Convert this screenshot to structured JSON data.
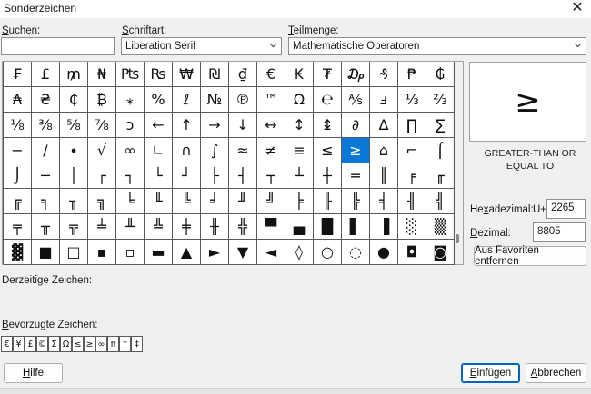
{
  "window": {
    "title": "Sonderzeichen",
    "close_glyph": "✕"
  },
  "search": {
    "label_mnemonic": "S",
    "label_rest": "uchen:",
    "value": "",
    "placeholder": ""
  },
  "font": {
    "label_mnemonic": "S",
    "label_rest": "chriftart:",
    "value": "Liberation Serif"
  },
  "subset": {
    "label_mnemonic": "T",
    "label_rest": "eilmenge:",
    "value": "Mathematische Operatoren"
  },
  "grid": {
    "rows": [
      [
        "₣",
        "£",
        "₥",
        "₦",
        "₧",
        "₨",
        "₩",
        "₪",
        "₫",
        "€",
        "₭",
        "₮",
        "₯",
        "₰",
        "₱",
        "₲"
      ],
      [
        "₳",
        "₴",
        "₵",
        "₿",
        "⁎",
        "%",
        "ℓ",
        "№",
        "℗",
        "™",
        "Ω",
        "℮",
        "⅍",
        "ⅎ",
        "⅓",
        "⅔"
      ],
      [
        "⅛",
        "⅜",
        "⅝",
        "⅞",
        "ↄ",
        "←",
        "↑",
        "→",
        "↓",
        "↔",
        "↕",
        "↨",
        "∂",
        "∆",
        "∏",
        "∑"
      ],
      [
        "−",
        "∕",
        "∙",
        "√",
        "∞",
        "∟",
        "∩",
        "∫",
        "≈",
        "≠",
        "≡",
        "≤",
        "≥",
        "⌂",
        "⌐",
        "⌠"
      ],
      [
        "⌡",
        "─",
        "│",
        "┌",
        "┐",
        "└",
        "┘",
        "├",
        "┤",
        "┬",
        "┴",
        "┼",
        "═",
        "║",
        "╒",
        "╓"
      ],
      [
        "╔",
        "╕",
        "╖",
        "╗",
        "╘",
        "╙",
        "╚",
        "╛",
        "╜",
        "╝",
        "╞",
        "╟",
        "╠",
        "╡",
        "╢",
        "╣"
      ],
      [
        "╤",
        "╥",
        "╦",
        "╧",
        "╨",
        "╩",
        "╪",
        "╫",
        "╬",
        "▀",
        "▄",
        "█",
        "▌",
        "▐",
        "░",
        "▒"
      ],
      [
        "▓",
        "■",
        "□",
        "▪",
        "▫",
        "▬",
        "▲",
        "►",
        "▼",
        "◄",
        "◊",
        "○",
        "◌",
        "●",
        "◘",
        "◙"
      ]
    ],
    "selected_row": 3,
    "selected_col": 12
  },
  "preview": {
    "glyph": "≥",
    "name": "GREATER-THAN OR EQUAL TO"
  },
  "hex": {
    "label_mnemonic": "x",
    "label_pre": "He",
    "label_post": "adezimal:",
    "prefix": "U+",
    "value": "2265"
  },
  "dec": {
    "label_mnemonic": "D",
    "label_rest": "ezimal:",
    "value": "8805"
  },
  "favorites_button": "Aus Favoriten entfernen",
  "current_label": "Derzeitige Zeichen:",
  "preferred": {
    "label_mnemonic": "B",
    "label_rest": "evorzugte Zeichen:",
    "chars": [
      "€",
      "¥",
      "£",
      "©",
      "Σ",
      "Ω",
      "≤",
      "≥",
      "∞",
      "π",
      "†",
      "‡"
    ]
  },
  "buttons": {
    "help_mnemonic": "H",
    "help_rest": "ilfe",
    "insert_mnemonic": "E",
    "insert_rest": "infügen",
    "cancel_mnemonic": "A",
    "cancel_rest": "bbrechen"
  },
  "colors": {
    "selection": "#0a78d7",
    "dialog_bg": "#f0f0f0",
    "accent_border": "#0067c0"
  }
}
